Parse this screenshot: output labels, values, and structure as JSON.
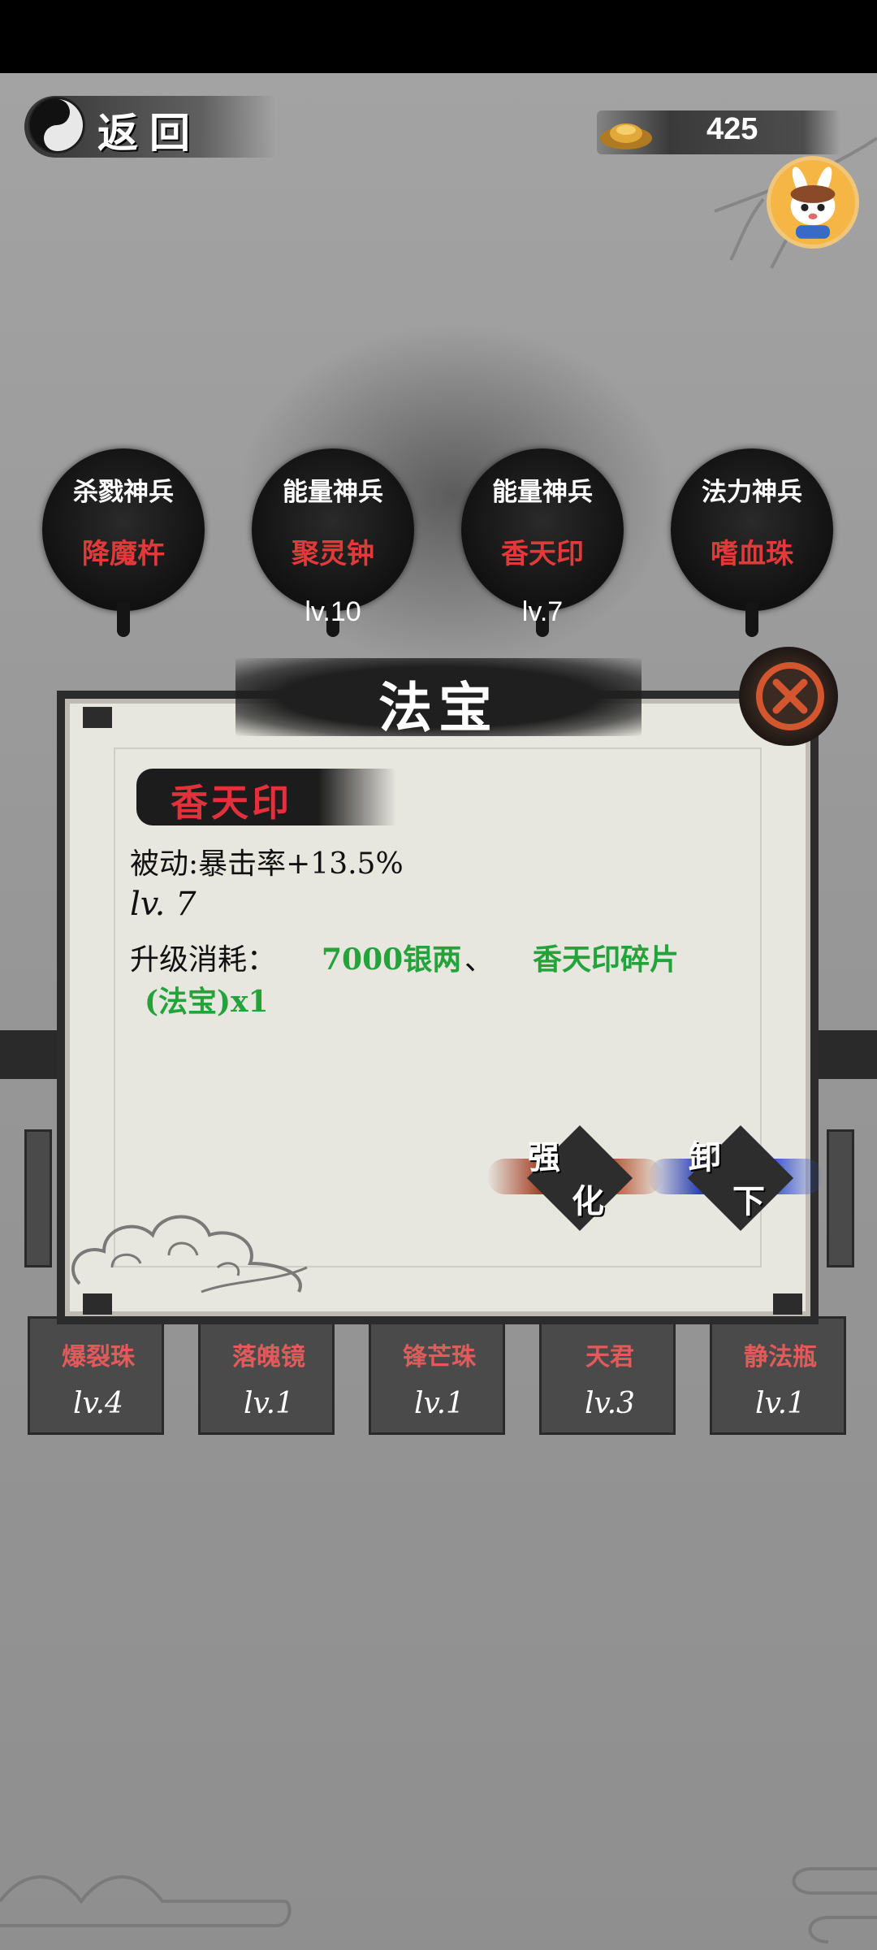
{
  "header": {
    "back_label": "返回",
    "currency_value": "425"
  },
  "equipped_slots": [
    {
      "type": "杀戮神兵",
      "name": "降魔杵",
      "level": ""
    },
    {
      "type": "能量神兵",
      "name": "聚灵钟",
      "level": "lv.10"
    },
    {
      "type": "能量神兵",
      "name": "香天印",
      "level": "lv.7"
    },
    {
      "type": "法力神兵",
      "name": "嗜血珠",
      "level": ""
    }
  ],
  "inventory": [
    {
      "name": "爆裂珠",
      "level": "lv.4"
    },
    {
      "name": "落魄镜",
      "level": "lv.1"
    },
    {
      "name": "锋芒珠",
      "level": "lv.1"
    },
    {
      "name": "天君",
      "level": "lv.3"
    },
    {
      "name": "静法瓶",
      "level": "lv.1"
    }
  ],
  "modal": {
    "title": "法宝",
    "item_name": "香天印",
    "passive": "被动:暴击率+13.5%",
    "level": "lv. 7",
    "cost_label": "升级消耗：",
    "cost_silver": "7000银两",
    "cost_separator": "、",
    "cost_item": "香天印碎片",
    "cost_item_2": "(法宝)x1",
    "strengthen_1": "强",
    "strengthen_2": "化",
    "unequip_1": "卸",
    "unequip_2": "下"
  },
  "colors": {
    "accent_red": "#e2313b",
    "cost_green": "#24a33a",
    "strengthen_ink": "#b6502f",
    "unequip_ink": "#3650d0"
  },
  "icons": [
    "yin-yang-icon",
    "gold-ingot-icon",
    "avatar-rabbit-icon",
    "close-icon",
    "cloud-ornament-icon"
  ]
}
